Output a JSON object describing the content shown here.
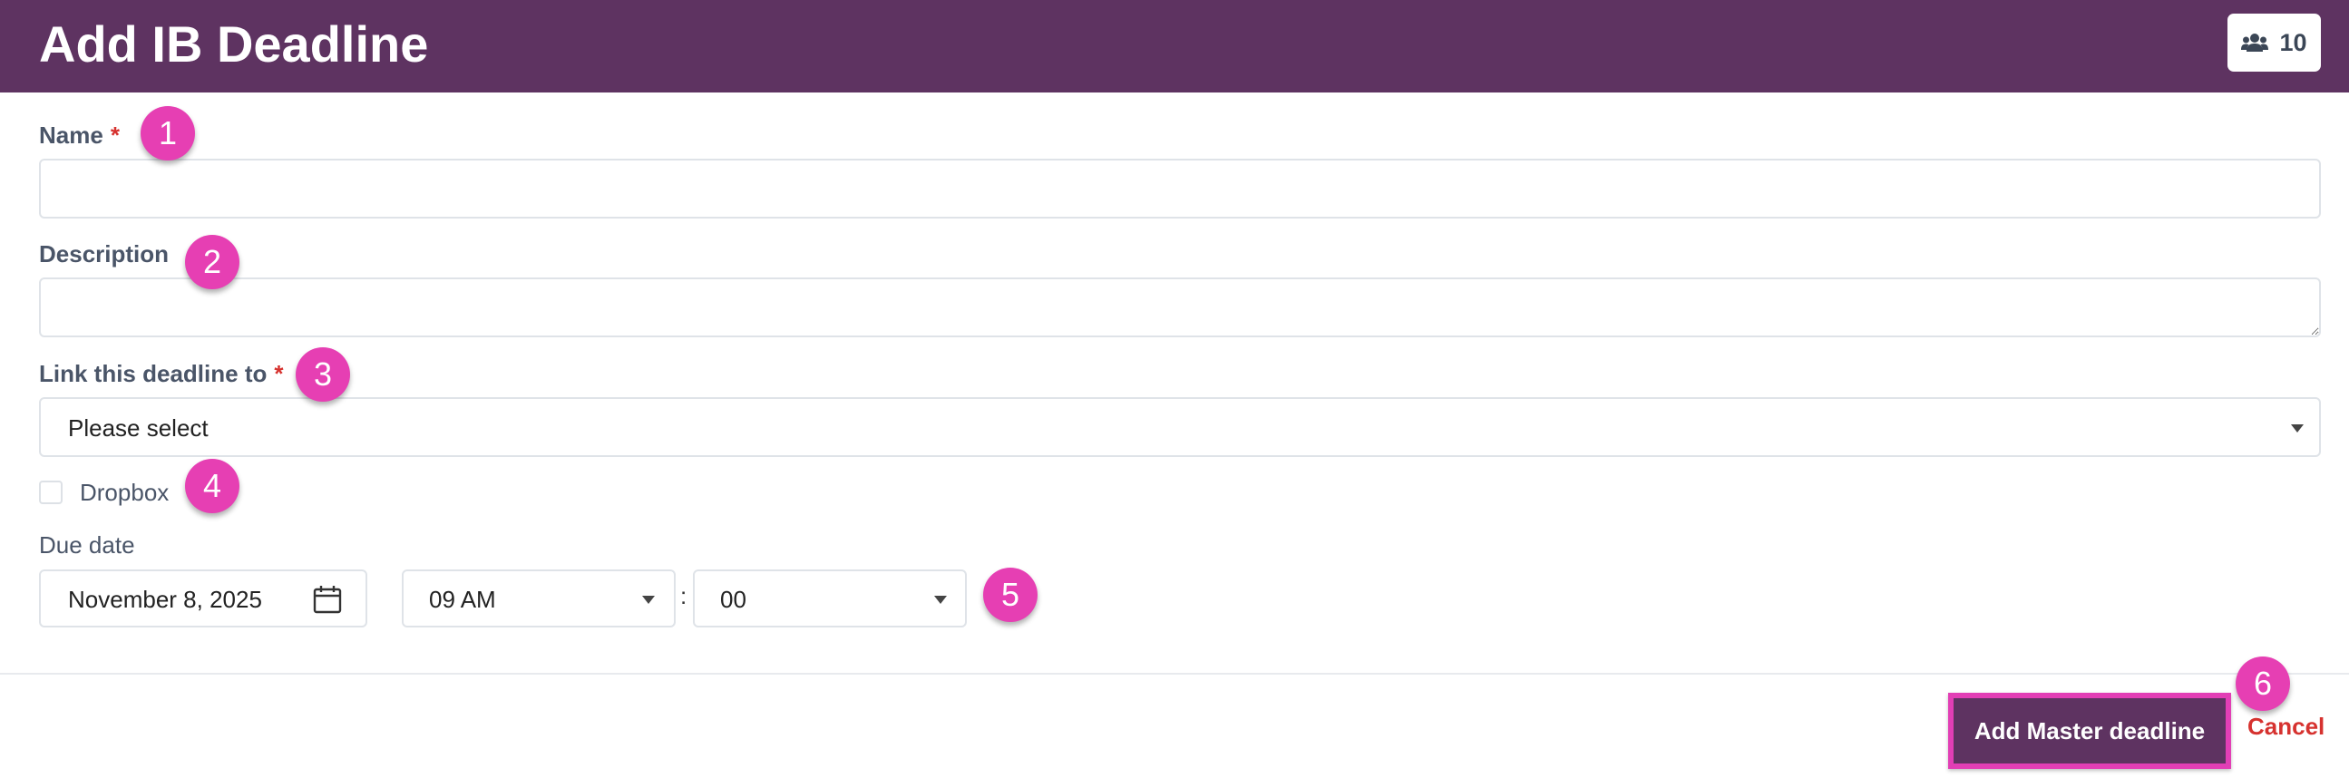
{
  "header": {
    "title": "Add IB Deadline",
    "member_count": "10",
    "member_icon": "users-icon"
  },
  "form": {
    "name_label": "Name",
    "name_value": "",
    "description_label": "Description",
    "description_value": "",
    "link_label": "Link this deadline to",
    "link_selected": "Please select",
    "required_mark": "*",
    "dropbox_label": "Dropbox",
    "dropbox_checked": false,
    "due_date_label": "Due date",
    "due_date_value": "November 8, 2025",
    "hour_value": "09 AM",
    "minute_value": "00",
    "time_separator": ":"
  },
  "actions": {
    "submit_label": "Add Master deadline",
    "cancel_label": "Cancel"
  },
  "markers": [
    "1",
    "2",
    "3",
    "4",
    "5",
    "6"
  ],
  "colors": {
    "header_bg": "#5e3361",
    "marker": "#e63fb3",
    "required": "#d6322f",
    "cancel": "#d6322f"
  }
}
